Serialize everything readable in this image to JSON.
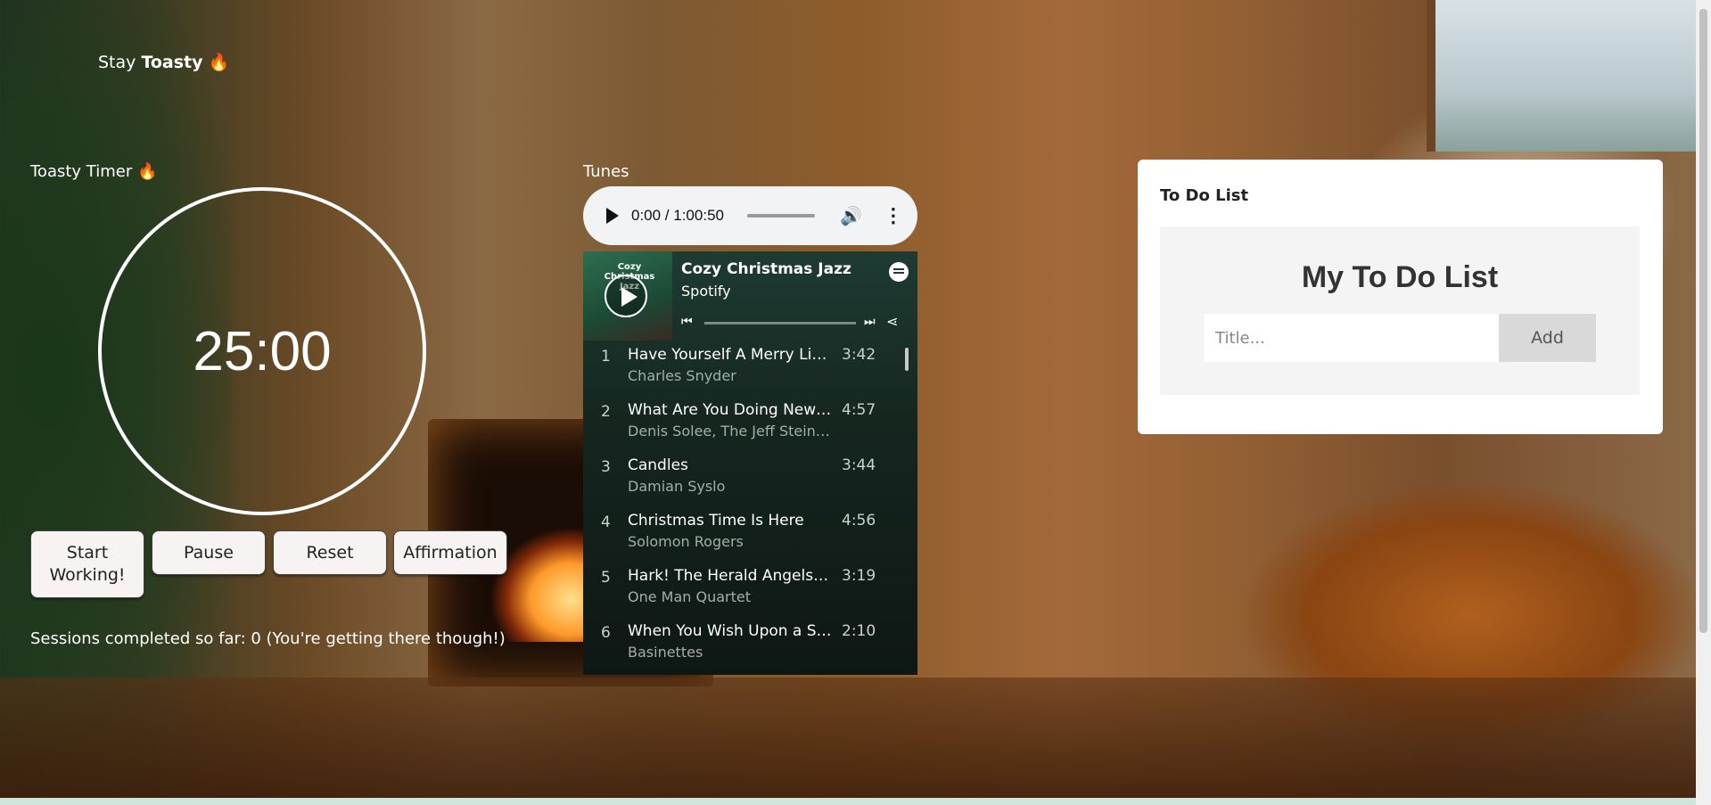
{
  "brand": {
    "prefix": "Stay ",
    "strong": "Toasty",
    "emoji": "🔥"
  },
  "timer": {
    "title": "Toasty Timer 🔥",
    "value": "25:00",
    "buttons": {
      "start": "Start Working!",
      "pause": "Pause",
      "reset": "Reset",
      "affirmation": "Affirmation"
    },
    "sessions": "Sessions completed so far: 0 (You're getting there though!)"
  },
  "tunes": {
    "title": "Tunes",
    "audio": {
      "time": "0:00 / 1:00:50"
    },
    "spotify": {
      "cover_text": "Cozy Christmas Jazz",
      "playlist": "Cozy Christmas Jazz",
      "subtitle": "Spotify",
      "tracks": [
        {
          "num": "1",
          "title": "Have Yourself A Merry Little ...",
          "artist": "Charles Snyder",
          "duration": "3:42"
        },
        {
          "num": "2",
          "title": "What Are You Doing New Ye...",
          "artist": "Denis Solee, The Jeff Steinb...",
          "duration": "4:57"
        },
        {
          "num": "3",
          "title": "Candles",
          "artist": "Damian Syslo",
          "duration": "3:44"
        },
        {
          "num": "4",
          "title": "Christmas Time Is Here",
          "artist": "Solomon Rogers",
          "duration": "4:56"
        },
        {
          "num": "5",
          "title": "Hark! The Herald Angels Sin...",
          "artist": "One Man Quartet",
          "duration": "3:19"
        },
        {
          "num": "6",
          "title": "When You Wish Upon a Star",
          "artist": "Basinettes",
          "duration": "2:10"
        }
      ]
    }
  },
  "todo": {
    "label": "To Do List",
    "heading": "My To Do List",
    "placeholder": "Title...",
    "add": "Add"
  },
  "icons": {
    "play": "play-icon",
    "volume": "volume-icon",
    "more": "more-vert-icon",
    "prev": "skip-previous-icon",
    "next": "skip-next-icon",
    "share": "share-icon",
    "spotify": "spotify-icon"
  }
}
